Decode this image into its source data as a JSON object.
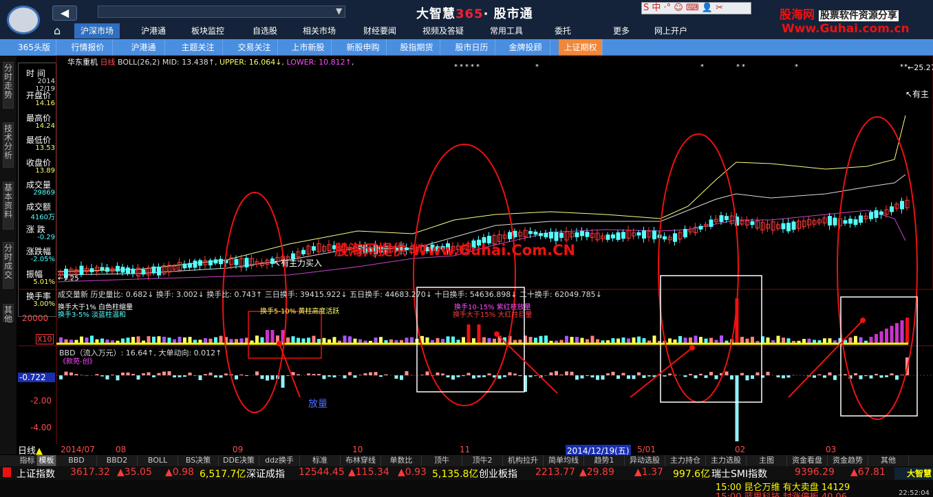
{
  "topbar": {
    "brand_a": "大智慧",
    "brand_b": "365",
    "brand_c": "· 股市通",
    "ime": "S 中 ·° ☺ ⌨ 👤 ✂",
    "watermark_title": "股海网",
    "watermark_slogan": "股票软件资源分享",
    "watermark_url": "Www.Guhai.com.cn"
  },
  "menu1": [
    "沪深市场",
    "沪港通",
    "板块监控",
    "自选股",
    "相关市场",
    "财经要闻",
    "视频及答疑",
    "常用工具",
    "委托",
    "更多",
    "网上开户"
  ],
  "menu2": [
    "365头版",
    "行情报价",
    "沪港通",
    "主题关注",
    "交易关注",
    "上市新股",
    "新股申购",
    "股指期货",
    "股市日历",
    "金牌投顾",
    "上证期权"
  ],
  "lefttabs": [
    "分时走势",
    "技术分析",
    "基本资料",
    "分时成交",
    "其他"
  ],
  "info": {
    "labels": [
      "时 间",
      "开盘价",
      "最高价",
      "最低价",
      "收盘价",
      "成交量",
      "成交额",
      "涨 跌",
      "涨跌幅",
      "振幅",
      "换手率"
    ],
    "values": [
      "2014",
      "14.16",
      "14.24",
      "13.53",
      "13.89",
      "29869",
      "4160万",
      "-0.29",
      "-2.05%",
      "5.01%",
      "3.00%"
    ],
    "date2": "12/19"
  },
  "chart": {
    "stock": "华东重机",
    "period": "日线",
    "boll_label": "BOLL(26,2)",
    "mid": "MID: 13.438↑",
    "upper": "UPPER: 16.064↓",
    "lower": "LOWER: 10.812↑",
    "right_price": "←25.27",
    "note_buy": "↖有主力买入",
    "note_right": "↖有主",
    "low_price": "←9.25",
    "watermark": "股海网提供 Www.Guhai.Com.CN",
    "vol_line": "成交量新  历史量比: 0.682↓  换手: 3.002↓  换手比: 0.743↑  三日换手: 39415.922↓  五日换手: 44683.270↓  十日换手: 54636.898↓  二十换手: 62049.785↓",
    "vol_y": "20000",
    "vol_x10": "X10",
    "vol_legend1": "换手大于1%  白色柱缩量",
    "vol_legend2": "换手3-5%  淡蓝柱温和",
    "vol_legend3": "换手5-10%  黄柱高度活跃",
    "vol_legend4": "换手10-15%  紫红柱放量",
    "vol_legend5": "换手大于15%  大红柱巨量",
    "bbd_line": "BBD（流入万元）: 16.64↑, 大单动向: 0.012↑",
    "bbd_sub": "《款苑-创》",
    "bbd_val": "-0.722",
    "bbd_y1": "-2.00",
    "bbd_y2": "-4.00",
    "annot": "放量",
    "dates": [
      "2014/07",
      "08",
      "09",
      "10",
      "11",
      "2014/12/19(五)",
      "5/01",
      "02",
      "03"
    ]
  },
  "bottomtabs": [
    "指标",
    "模板",
    "BBD",
    "BBD2",
    "BOLL",
    "BS决策",
    "DDE决策",
    "ddz换手",
    "标准",
    "布林穿线",
    "单数比",
    "顶牛",
    "顶牛2",
    "机构拉升",
    "简单均线",
    "趋势1",
    "异动选股",
    "主力持仓",
    "主力选股",
    "主图",
    "资金看盘",
    "资金趋势",
    "其他"
  ],
  "ticker": {
    "sh_name": "上证指数",
    "sh_val": "3617.32",
    "sh_chg": "▲35.05",
    "sh_pct": "▲0.98",
    "sh_amt": "6,517.7亿",
    "sz_name": "深证成指",
    "sz_val": "12544.45",
    "sz_chg": "▲115.34",
    "sz_pct": "▲0.93",
    "sz_amt": "5,135.8亿",
    "cy_name": "创业板指",
    "cy_val": "2213.77",
    "cy_chg": "▲29.89",
    "cy_pct": "▲1.37",
    "cy_amt": "997.6亿",
    "smi_name": "瑞士SMI指数",
    "smi_val": "9396.29",
    "smi_chg": "▲67.81",
    "news1": "15:00 昆仑万维 有大卖盘 14129",
    "news2": "15:00 蓝思科技 封涨停板 40.06",
    "clock": "22:52:04",
    "badge": "大智慧"
  },
  "colors": {
    "up": "#ff3b3b",
    "down": "#54ffff",
    "yellow": "#ffff00",
    "magenta": "#ff4cff"
  }
}
